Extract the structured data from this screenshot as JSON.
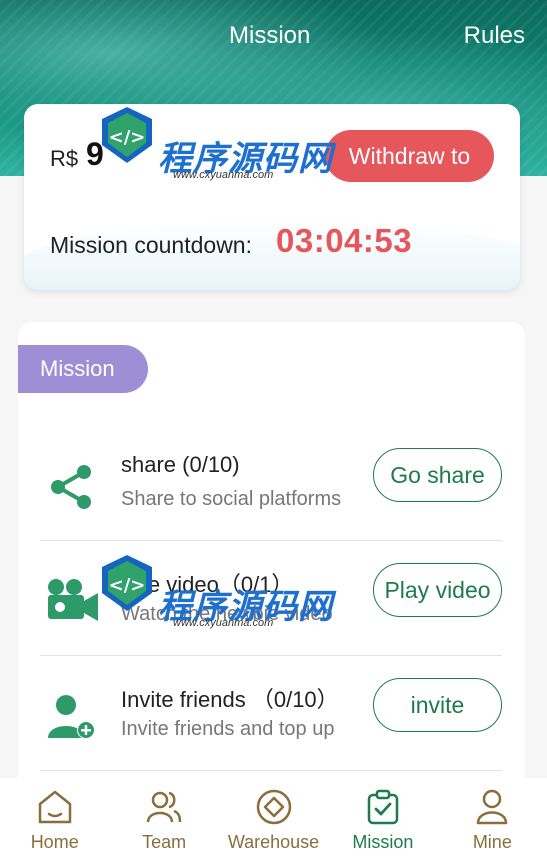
{
  "header": {
    "title": "Mission",
    "rules_label": "Rules"
  },
  "balance": {
    "currency": "R$",
    "amount": "9",
    "withdraw_label": "Withdraw to",
    "countdown_label": "Mission countdown:",
    "countdown_value": "03:04:53"
  },
  "mission_section": {
    "tag_label": "Mission",
    "tasks": [
      {
        "title": "share (0/10)",
        "description": "Share to social platforms",
        "action_label": "Go share",
        "icon": "share-icon"
      },
      {
        "title": "vice video（0/1）",
        "description": "Watch the newbie video",
        "action_label": "Play video",
        "icon": "video-camera-icon"
      },
      {
        "title": "Invite friends （0/10）",
        "description": "Invite friends and top up",
        "action_label": "invite",
        "icon": "add-user-icon"
      }
    ]
  },
  "watermark": {
    "text": "程序源码网",
    "url": "www.cxyuanma.com"
  },
  "tabbar": {
    "items": [
      {
        "label": "Home",
        "icon": "home-icon"
      },
      {
        "label": "Team",
        "icon": "team-icon"
      },
      {
        "label": "Warehouse",
        "icon": "warehouse-icon"
      },
      {
        "label": "Mission",
        "icon": "mission-icon"
      },
      {
        "label": "Mine",
        "icon": "user-icon"
      }
    ],
    "active_index": 3
  },
  "colors": {
    "accent_red": "#e5575b",
    "accent_green": "#1f7a4f",
    "tag_purple": "#9d8ed6",
    "tab_brown": "#8a6d3b"
  }
}
